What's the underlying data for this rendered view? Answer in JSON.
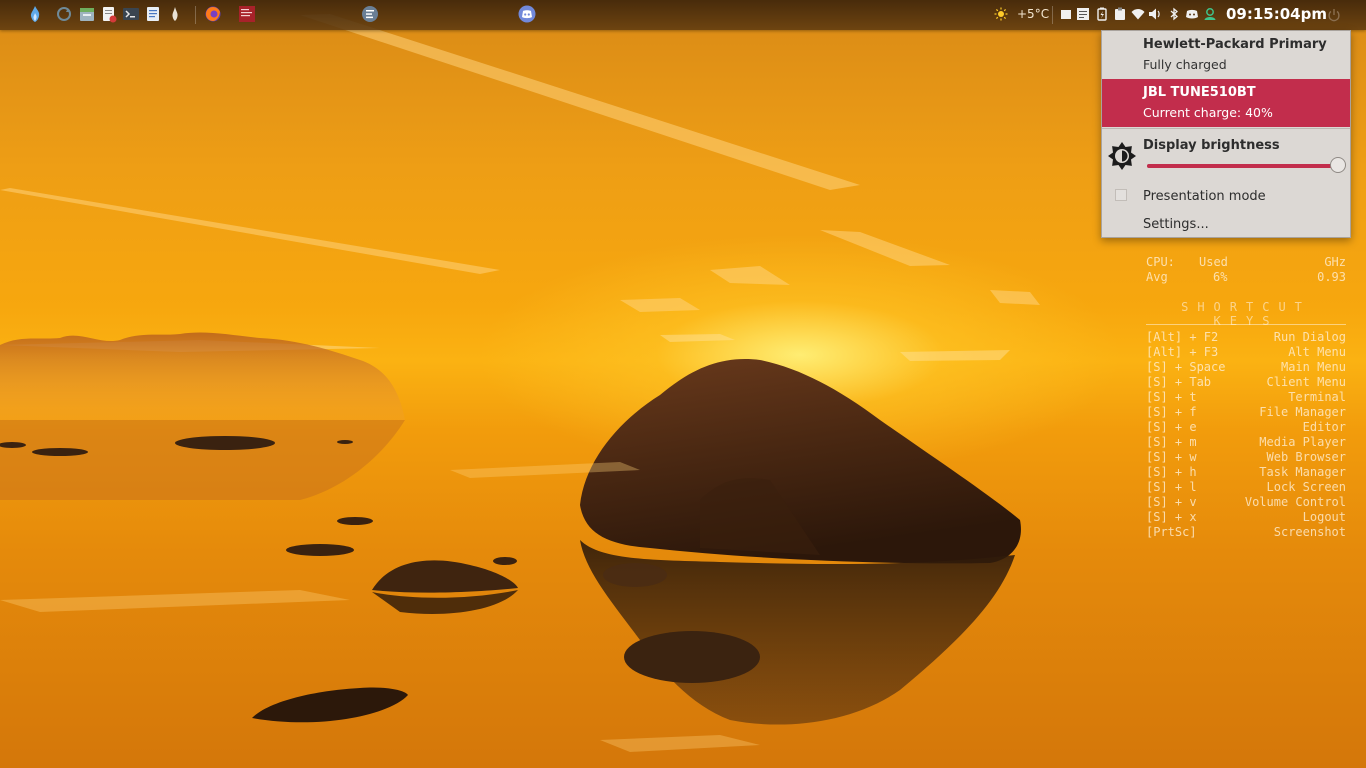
{
  "panel": {
    "launchers": [
      {
        "icon": "flame-menu-icon"
      },
      {
        "icon": "refresh-icon"
      },
      {
        "icon": "file-manager-icon"
      },
      {
        "icon": "text-editor-icon"
      },
      {
        "icon": "terminal-icon"
      },
      {
        "icon": "document-icon"
      },
      {
        "icon": "small-flame-icon"
      }
    ],
    "running": [
      {
        "icon": "firefox-icon"
      },
      {
        "icon": "red-app-icon"
      },
      {
        "icon": "task-list-icon"
      },
      {
        "icon": "discord-icon"
      }
    ],
    "weather_icon": "sun-icon",
    "temperature": "+5°C",
    "tray": [
      "window-icon",
      "notes-icon",
      "battery-icon",
      "clipboard-icon",
      "wifi-icon",
      "volume-icon",
      "bluetooth-icon",
      "discord-tray-icon",
      "vpn-icon"
    ],
    "clock": "09:15:04pm",
    "power_icon": "power-icon"
  },
  "popup": {
    "devices": [
      {
        "title": "Hewlett-Packard Primary",
        "status": "Fully charged",
        "selected": false
      },
      {
        "title": "JBL TUNE510BT",
        "status": "Current charge: 40%",
        "selected": true
      }
    ],
    "brightness": {
      "label": "Display brightness",
      "value": 0.99
    },
    "presentation_label": "Presentation mode",
    "presentation_checked": false,
    "settings_label": "Settings..."
  },
  "conky": {
    "cpu": {
      "label": "CPU:",
      "used_label": "Used",
      "ghz_label": "GHz",
      "avg_label": "Avg",
      "avg_used": "6%",
      "avg_ghz": "0.93"
    },
    "shortcuts_title": "SHORTCUT KEYS",
    "shortcuts": [
      {
        "key": "[Alt] + F2",
        "action": "Run Dialog"
      },
      {
        "key": "[Alt] + F3",
        "action": "Alt Menu"
      },
      {
        "key": "[S] + Space",
        "action": "Main Menu"
      },
      {
        "key": "[S] + Tab",
        "action": "Client Menu"
      },
      {
        "key": "[S] + t",
        "action": "Terminal"
      },
      {
        "key": "[S] + f",
        "action": "File Manager"
      },
      {
        "key": "[S] + e",
        "action": "Editor"
      },
      {
        "key": "[S] + m",
        "action": "Media Player"
      },
      {
        "key": "[S] + w",
        "action": "Web Browser"
      },
      {
        "key": "[S] + h",
        "action": "Task Manager"
      },
      {
        "key": "[S] + l",
        "action": "Lock Screen"
      },
      {
        "key": "[S] + v",
        "action": "Volume Control"
      },
      {
        "key": "[S] + x",
        "action": "Logout"
      },
      {
        "key": "[PrtSc]",
        "action": "Screenshot"
      }
    ]
  },
  "colors": {
    "accent": "#c22d4c",
    "popup_bg": "#dcd8d4"
  }
}
